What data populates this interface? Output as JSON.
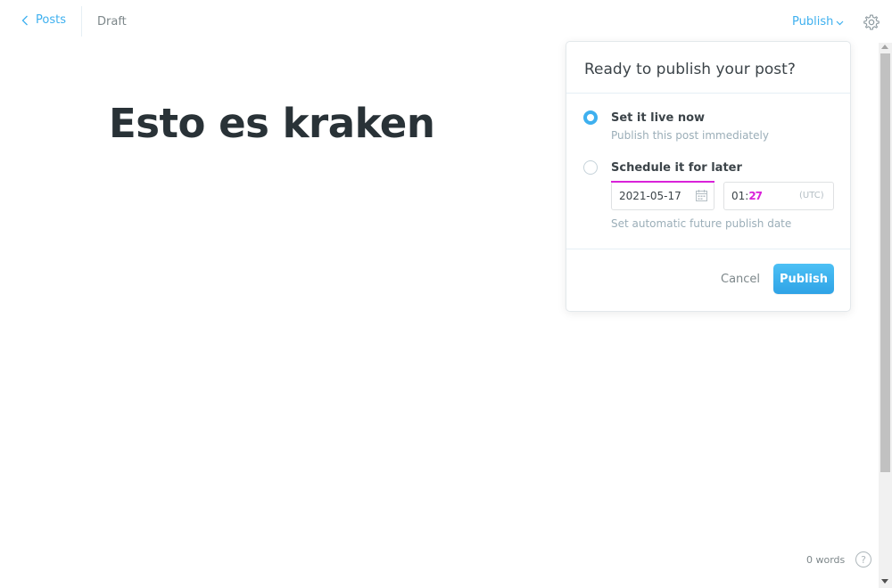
{
  "header": {
    "back_label": "Posts",
    "status": "Draft",
    "publish_label": "Publish"
  },
  "editor": {
    "title": "Esto es kraken"
  },
  "footer": {
    "word_count": "0 words",
    "help_label": "?"
  },
  "publish_popover": {
    "title": "Ready to publish your post?",
    "options": [
      {
        "label": "Set it live now",
        "description": "Publish this post immediately",
        "selected": true
      },
      {
        "label": "Schedule it for later",
        "description": "",
        "selected": false
      }
    ],
    "date_value": "2021-05-17",
    "time_hour": "01:",
    "time_minutes": "27",
    "timezone": "(UTC)",
    "hint": "Set automatic future publish date",
    "cancel_label": "Cancel",
    "publish_label": "Publish"
  },
  "colors": {
    "accent": "#3eb0ef",
    "focus_accent": "#d921d9",
    "title_text": "#293237",
    "muted_text": "#7d878a"
  },
  "icons": {
    "back": "chevron-left-icon",
    "dropdown": "chevron-down-icon",
    "settings": "gear-icon",
    "calendar": "calendar-icon",
    "help": "question-circle-icon"
  }
}
